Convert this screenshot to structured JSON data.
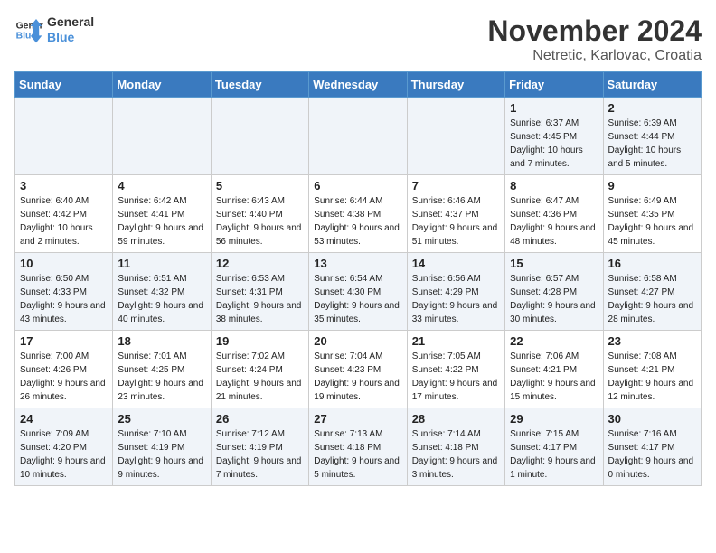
{
  "logo": {
    "line1": "General",
    "line2": "Blue"
  },
  "title": "November 2024",
  "location": "Netretic, Karlovac, Croatia",
  "weekdays": [
    "Sunday",
    "Monday",
    "Tuesday",
    "Wednesday",
    "Thursday",
    "Friday",
    "Saturday"
  ],
  "weeks": [
    [
      {
        "day": "",
        "info": ""
      },
      {
        "day": "",
        "info": ""
      },
      {
        "day": "",
        "info": ""
      },
      {
        "day": "",
        "info": ""
      },
      {
        "day": "",
        "info": ""
      },
      {
        "day": "1",
        "info": "Sunrise: 6:37 AM\nSunset: 4:45 PM\nDaylight: 10 hours and 7 minutes."
      },
      {
        "day": "2",
        "info": "Sunrise: 6:39 AM\nSunset: 4:44 PM\nDaylight: 10 hours and 5 minutes."
      }
    ],
    [
      {
        "day": "3",
        "info": "Sunrise: 6:40 AM\nSunset: 4:42 PM\nDaylight: 10 hours and 2 minutes."
      },
      {
        "day": "4",
        "info": "Sunrise: 6:42 AM\nSunset: 4:41 PM\nDaylight: 9 hours and 59 minutes."
      },
      {
        "day": "5",
        "info": "Sunrise: 6:43 AM\nSunset: 4:40 PM\nDaylight: 9 hours and 56 minutes."
      },
      {
        "day": "6",
        "info": "Sunrise: 6:44 AM\nSunset: 4:38 PM\nDaylight: 9 hours and 53 minutes."
      },
      {
        "day": "7",
        "info": "Sunrise: 6:46 AM\nSunset: 4:37 PM\nDaylight: 9 hours and 51 minutes."
      },
      {
        "day": "8",
        "info": "Sunrise: 6:47 AM\nSunset: 4:36 PM\nDaylight: 9 hours and 48 minutes."
      },
      {
        "day": "9",
        "info": "Sunrise: 6:49 AM\nSunset: 4:35 PM\nDaylight: 9 hours and 45 minutes."
      }
    ],
    [
      {
        "day": "10",
        "info": "Sunrise: 6:50 AM\nSunset: 4:33 PM\nDaylight: 9 hours and 43 minutes."
      },
      {
        "day": "11",
        "info": "Sunrise: 6:51 AM\nSunset: 4:32 PM\nDaylight: 9 hours and 40 minutes."
      },
      {
        "day": "12",
        "info": "Sunrise: 6:53 AM\nSunset: 4:31 PM\nDaylight: 9 hours and 38 minutes."
      },
      {
        "day": "13",
        "info": "Sunrise: 6:54 AM\nSunset: 4:30 PM\nDaylight: 9 hours and 35 minutes."
      },
      {
        "day": "14",
        "info": "Sunrise: 6:56 AM\nSunset: 4:29 PM\nDaylight: 9 hours and 33 minutes."
      },
      {
        "day": "15",
        "info": "Sunrise: 6:57 AM\nSunset: 4:28 PM\nDaylight: 9 hours and 30 minutes."
      },
      {
        "day": "16",
        "info": "Sunrise: 6:58 AM\nSunset: 4:27 PM\nDaylight: 9 hours and 28 minutes."
      }
    ],
    [
      {
        "day": "17",
        "info": "Sunrise: 7:00 AM\nSunset: 4:26 PM\nDaylight: 9 hours and 26 minutes."
      },
      {
        "day": "18",
        "info": "Sunrise: 7:01 AM\nSunset: 4:25 PM\nDaylight: 9 hours and 23 minutes."
      },
      {
        "day": "19",
        "info": "Sunrise: 7:02 AM\nSunset: 4:24 PM\nDaylight: 9 hours and 21 minutes."
      },
      {
        "day": "20",
        "info": "Sunrise: 7:04 AM\nSunset: 4:23 PM\nDaylight: 9 hours and 19 minutes."
      },
      {
        "day": "21",
        "info": "Sunrise: 7:05 AM\nSunset: 4:22 PM\nDaylight: 9 hours and 17 minutes."
      },
      {
        "day": "22",
        "info": "Sunrise: 7:06 AM\nSunset: 4:21 PM\nDaylight: 9 hours and 15 minutes."
      },
      {
        "day": "23",
        "info": "Sunrise: 7:08 AM\nSunset: 4:21 PM\nDaylight: 9 hours and 12 minutes."
      }
    ],
    [
      {
        "day": "24",
        "info": "Sunrise: 7:09 AM\nSunset: 4:20 PM\nDaylight: 9 hours and 10 minutes."
      },
      {
        "day": "25",
        "info": "Sunrise: 7:10 AM\nSunset: 4:19 PM\nDaylight: 9 hours and 9 minutes."
      },
      {
        "day": "26",
        "info": "Sunrise: 7:12 AM\nSunset: 4:19 PM\nDaylight: 9 hours and 7 minutes."
      },
      {
        "day": "27",
        "info": "Sunrise: 7:13 AM\nSunset: 4:18 PM\nDaylight: 9 hours and 5 minutes."
      },
      {
        "day": "28",
        "info": "Sunrise: 7:14 AM\nSunset: 4:18 PM\nDaylight: 9 hours and 3 minutes."
      },
      {
        "day": "29",
        "info": "Sunrise: 7:15 AM\nSunset: 4:17 PM\nDaylight: 9 hours and 1 minute."
      },
      {
        "day": "30",
        "info": "Sunrise: 7:16 AM\nSunset: 4:17 PM\nDaylight: 9 hours and 0 minutes."
      }
    ]
  ]
}
